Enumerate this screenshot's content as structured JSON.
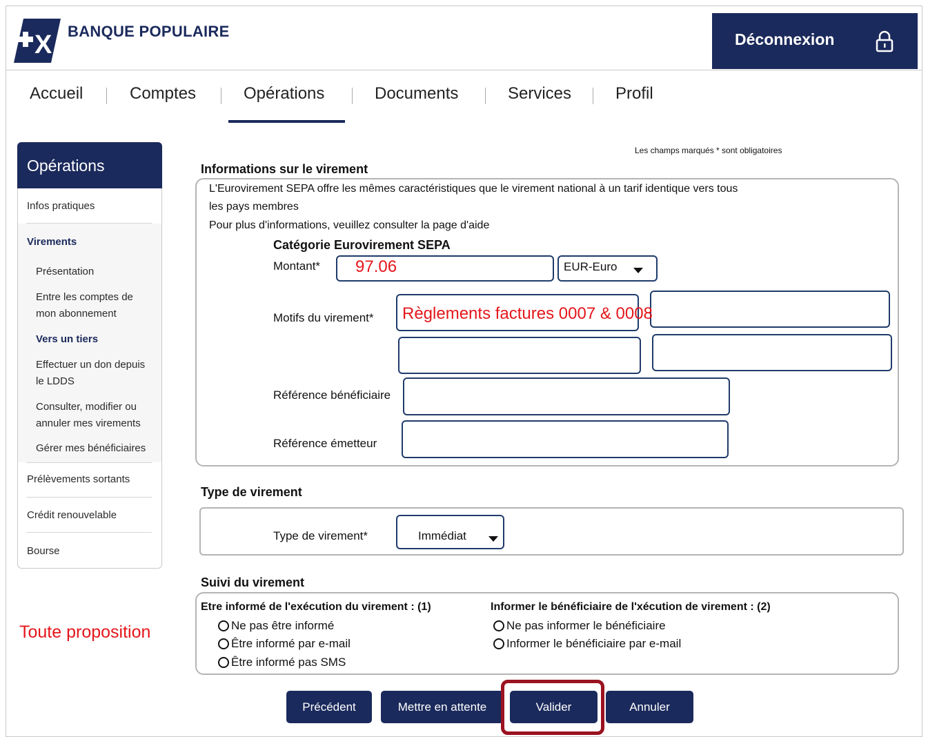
{
  "header": {
    "brand": "BANQUE POPULAIRE",
    "logo_mark": "+X",
    "logout_label": "Déconnexion",
    "accent": "#1b2a5c"
  },
  "nav": {
    "items": [
      "Accueil",
      "Comptes",
      "Opérations",
      "Documents",
      "Services",
      "Profil"
    ],
    "active": "Opérations"
  },
  "sidebar": {
    "title": "Opérations",
    "items": [
      "Infos pratiques",
      "Virements",
      "Présentation",
      "Entre les comptes de",
      "mon abonnement",
      "Vers un tiers",
      "Effectuer un don depuis",
      "le LDDS",
      "Consulter, modifier ou",
      "annuler mes virements",
      "Gérer mes bénéficiaires",
      "Prélèvements sortants",
      "Crédit renouvelable",
      "Bourse"
    ]
  },
  "form": {
    "required_note": "Les champs marqués * sont obligatoires",
    "info_title": "Informations sur le virement",
    "info_text_1": "L'Eurovirement SEPA offre les mêmes caractéristiques que le virement national à un tarif identique vers tous",
    "info_text_2": "les pays membres",
    "info_text_3": "Pour plus d'informations, veuillez consulter la page d'aide",
    "category": "Catégorie Eurovirement SEPA",
    "amount_label": "Montant*",
    "amount_value": "97.06",
    "currency": "EUR-Euro",
    "motif_label": "Motifs du virement*",
    "motif_value": "Règlements factures 0007 & 0008",
    "ref_benef_label": "Référence bénéficiaire",
    "ref_emetteur_label": "Référence émetteur",
    "type_title": "Type de virement",
    "type_label": "Type de virement*",
    "type_value": "Immédiat",
    "suivi_title": "Suivi du virement",
    "suivi_left_title": "Etre informé de l'exécution du virement : (1)",
    "suivi_left_options": [
      "Ne pas être informé",
      "Être informé par e-mail",
      "Être informé pas SMS"
    ],
    "suivi_right_title": "Informer le bénéficiaire de l'xécution de virement : (2)",
    "suivi_right_options": [
      "Ne pas informer le bénéficiaire",
      "Informer le bénéficiaire par e-mail"
    ]
  },
  "buttons": {
    "previous": "Précédent",
    "hold": "Mettre en attente",
    "validate": "Valider",
    "cancel": "Annuler"
  },
  "annotation": "Toute proposition",
  "colors": {
    "highlight": "#e4161b",
    "field_border": "#1f3a6b"
  }
}
